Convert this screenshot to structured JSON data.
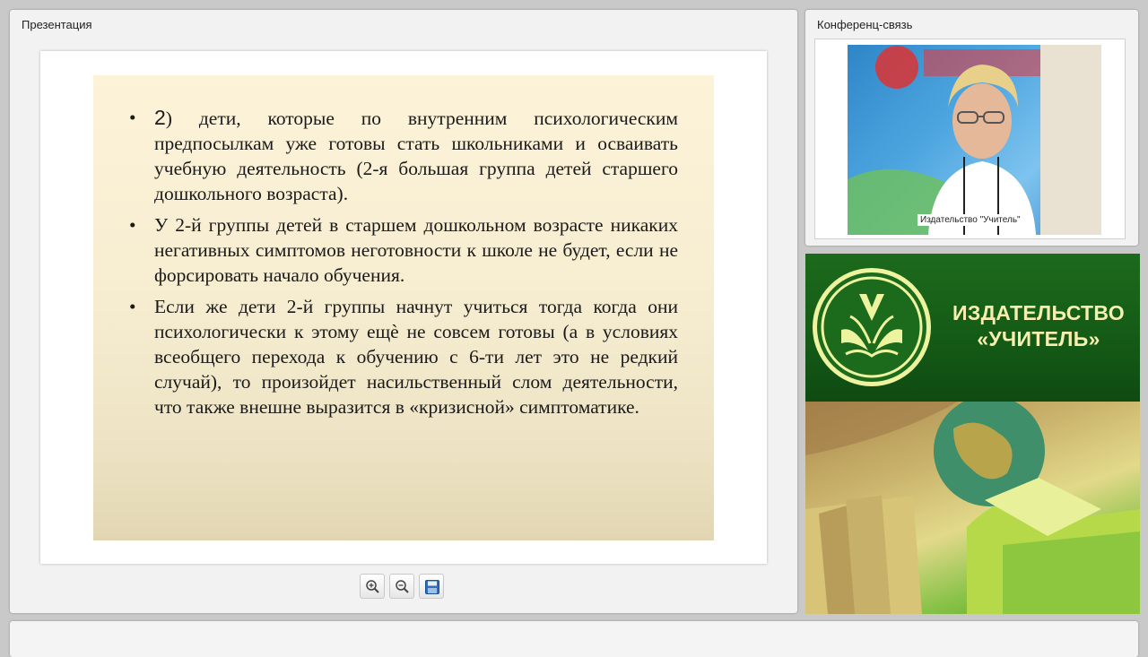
{
  "presentation": {
    "title": "Презентация",
    "slide": {
      "items": [
        {
          "bullet": "•",
          "number": "2",
          "text": ") дети, которые по внутренним психологическим предпосылкам уже готовы стать школьниками и осваивать учебную деятельность (2-я большая группа детей старшего дошкольного возраста)."
        },
        {
          "bullet": "•",
          "number": "",
          "text": " У 2-й группы детей в старшем дошкольном возрасте никаких негативных симптомов неготовности к школе не будет, если не форсировать начало обучения."
        },
        {
          "bullet": "•",
          "number": "",
          "text": "Если же дети 2-й группы начнут учиться тогда когда они психологически к этому ещè не совсем готовы (а в условиях всеобщего перехода к обучению с 6-ти лет это не редкий случай), то произойдет насильственный слом деятельности, что также внешне выразится в «кризисной» симптоматике."
        }
      ]
    },
    "toolbar": {
      "zoom_in_icon": "zoom-in-icon",
      "zoom_out_icon": "zoom-out-icon",
      "save_icon": "save-icon"
    }
  },
  "conference": {
    "title": "Конференц-связь",
    "video_label": "Издательство \"Учитель\""
  },
  "banner": {
    "line1": "ИЗДАТЕЛЬСТВО",
    "line2": "«УЧИТЕЛЬ»",
    "colors": {
      "green": "#145a16",
      "text": "#f6efb0"
    }
  }
}
